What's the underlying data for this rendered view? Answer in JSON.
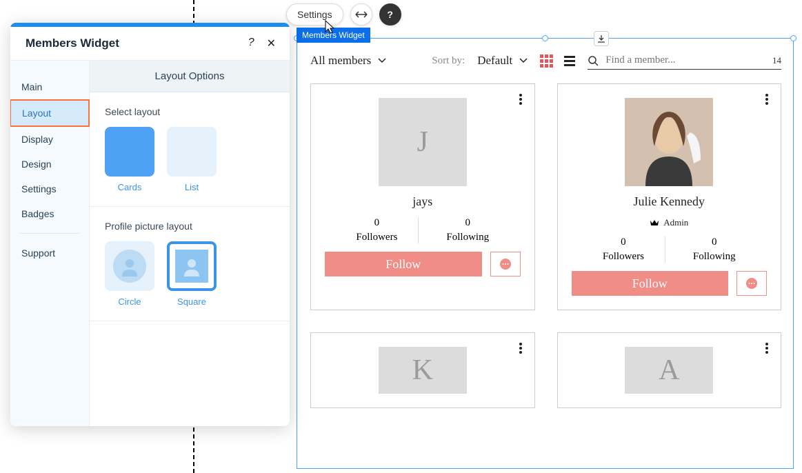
{
  "toolbar": {
    "settings_label": "Settings"
  },
  "widget_tab": "Members Widget",
  "panel": {
    "title": "Members Widget",
    "nav": {
      "main": "Main",
      "layout": "Layout",
      "display": "Display",
      "design": "Design",
      "settings": "Settings",
      "badges": "Badges",
      "support": "Support"
    },
    "layout_options_header": "Layout Options",
    "select_layout_label": "Select layout",
    "layout_cards": "Cards",
    "layout_list": "List",
    "profile_picture_layout_label": "Profile picture layout",
    "profile_circle": "Circle",
    "profile_square": "Square"
  },
  "header": {
    "all_members": "All members",
    "sort_by_label": "Sort by:",
    "sort_value": "Default",
    "search_placeholder": "Find a member...",
    "count": "14"
  },
  "members": [
    {
      "initial": "J",
      "name": "jays",
      "admin": false,
      "followers": "0",
      "followers_label": "Followers",
      "following": "0",
      "following_label": "Following",
      "follow_label": "Follow"
    },
    {
      "initial": "",
      "name": "Julie Kennedy",
      "admin": true,
      "admin_label": "Admin",
      "followers": "0",
      "followers_label": "Followers",
      "following": "0",
      "following_label": "Following",
      "follow_label": "Follow"
    },
    {
      "initial": "K"
    },
    {
      "initial": "A"
    }
  ]
}
